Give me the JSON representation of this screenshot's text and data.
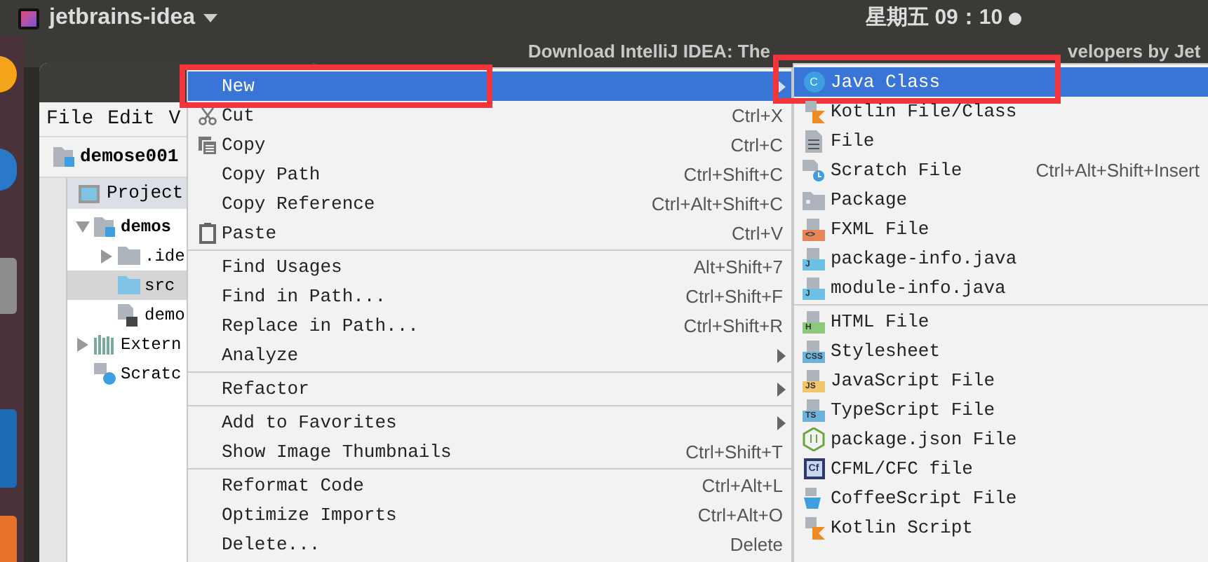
{
  "top_bar": {
    "app_name": "jetbrains-idea",
    "clock": "星期五 09：10"
  },
  "browser_window": {
    "title_parts": [
      "Download IntelliJ IDEA: The",
      "velopers by Jet"
    ]
  },
  "ide_window": {
    "menu_bar": [
      "File",
      "Edit",
      "V"
    ],
    "breadcrumb": "demose001",
    "project_panel": {
      "title": "Project",
      "tree": [
        {
          "label": "demos",
          "kind": "module",
          "expanded": true,
          "selected": false,
          "children": [
            {
              "label": ".ide",
              "kind": "folder",
              "expanded": false,
              "selected": false
            },
            {
              "label": "src",
              "kind": "source",
              "selected": true
            },
            {
              "label": "demo",
              "kind": "modulefile",
              "selected": false
            }
          ]
        },
        {
          "label": "Extern",
          "kind": "libraries",
          "expanded": false,
          "selected": false
        },
        {
          "label": "Scratc",
          "kind": "scratches",
          "selected": false
        }
      ]
    }
  },
  "context_menu": {
    "items": [
      {
        "kind": "item",
        "label": "New",
        "selected": true,
        "submenu": true,
        "annotated": true
      },
      {
        "kind": "scissors",
        "label": "Cut",
        "shortcut": "Ctrl+X",
        "selected": false
      },
      {
        "kind": "copy",
        "label": "Copy",
        "shortcut": "Ctrl+C",
        "selected": false
      },
      {
        "kind": "item",
        "label": "Copy Path",
        "shortcut": "Ctrl+Shift+C",
        "selected": false
      },
      {
        "kind": "item",
        "label": "Copy Reference",
        "shortcut": "Ctrl+Alt+Shift+C",
        "selected": false
      },
      {
        "kind": "clipboard",
        "label": "Paste",
        "shortcut": "Ctrl+V",
        "selected": false
      },
      {
        "kind": "separator"
      },
      {
        "kind": "item",
        "label": "Find Usages",
        "shortcut": "Alt+Shift+7",
        "selected": false
      },
      {
        "kind": "item",
        "label": "Find in Path...",
        "shortcut": "Ctrl+Shift+F",
        "selected": false
      },
      {
        "kind": "item",
        "label": "Replace in Path...",
        "shortcut": "Ctrl+Shift+R",
        "selected": false
      },
      {
        "kind": "item",
        "label": "Analyze",
        "submenu": true,
        "selected": false
      },
      {
        "kind": "separator"
      },
      {
        "kind": "item",
        "label": "Refactor",
        "submenu": true,
        "selected": false
      },
      {
        "kind": "separator"
      },
      {
        "kind": "item",
        "label": "Add to Favorites",
        "submenu": true,
        "selected": false
      },
      {
        "kind": "item",
        "label": "Show Image Thumbnails",
        "shortcut": "Ctrl+Shift+T",
        "selected": false
      },
      {
        "kind": "separator"
      },
      {
        "kind": "item",
        "label": "Reformat Code",
        "shortcut": "Ctrl+Alt+L",
        "selected": false
      },
      {
        "kind": "item",
        "label": "Optimize Imports",
        "shortcut": "Ctrl+Alt+O",
        "selected": false
      },
      {
        "kind": "item",
        "label": "Delete...",
        "shortcut": "Delete",
        "selected": false
      }
    ]
  },
  "new_submenu": {
    "items": [
      {
        "kind": "class",
        "label": "Java Class",
        "badge": "C",
        "selected": true,
        "annotated": true
      },
      {
        "kind": "kotlin",
        "label": "Kotlin File/Class",
        "selected": false
      },
      {
        "kind": "textfile",
        "label": "File",
        "selected": false
      },
      {
        "kind": "scratch",
        "label": "Scratch File",
        "shortcut": "Ctrl+Alt+Shift+Insert",
        "selected": false
      },
      {
        "kind": "package",
        "label": "Package",
        "selected": false
      },
      {
        "kind": "typed",
        "label": "FXML File",
        "badge": "<>",
        "color": "#e8835a",
        "selected": false
      },
      {
        "kind": "typed",
        "label": "package-info.java",
        "badge": "J",
        "color": "#6cc0e5",
        "selected": false
      },
      {
        "kind": "typed",
        "label": "module-info.java",
        "badge": "J",
        "color": "#6cc0e5",
        "selected": false
      },
      {
        "kind": "separator"
      },
      {
        "kind": "typed",
        "label": "HTML File",
        "badge": "H",
        "color": "#8cc97a",
        "selected": false
      },
      {
        "kind": "typed",
        "label": "Stylesheet",
        "badge": "CSS",
        "color": "#6cb2dc",
        "selected": false
      },
      {
        "kind": "typed",
        "label": "JavaScript File",
        "badge": "JS",
        "color": "#f2c66d",
        "selected": false
      },
      {
        "kind": "typed",
        "label": "TypeScript File",
        "badge": "TS",
        "color": "#6cb2dc",
        "selected": false
      },
      {
        "kind": "nodejs",
        "label": "package.json File",
        "selected": false
      },
      {
        "kind": "cfml",
        "label": "CFML/CFC file",
        "badge": "Cf",
        "selected": false
      },
      {
        "kind": "coffee",
        "label": "CoffeeScript File",
        "selected": false
      },
      {
        "kind": "kotlin",
        "label": "Kotlin Script",
        "selected": false
      }
    ]
  }
}
